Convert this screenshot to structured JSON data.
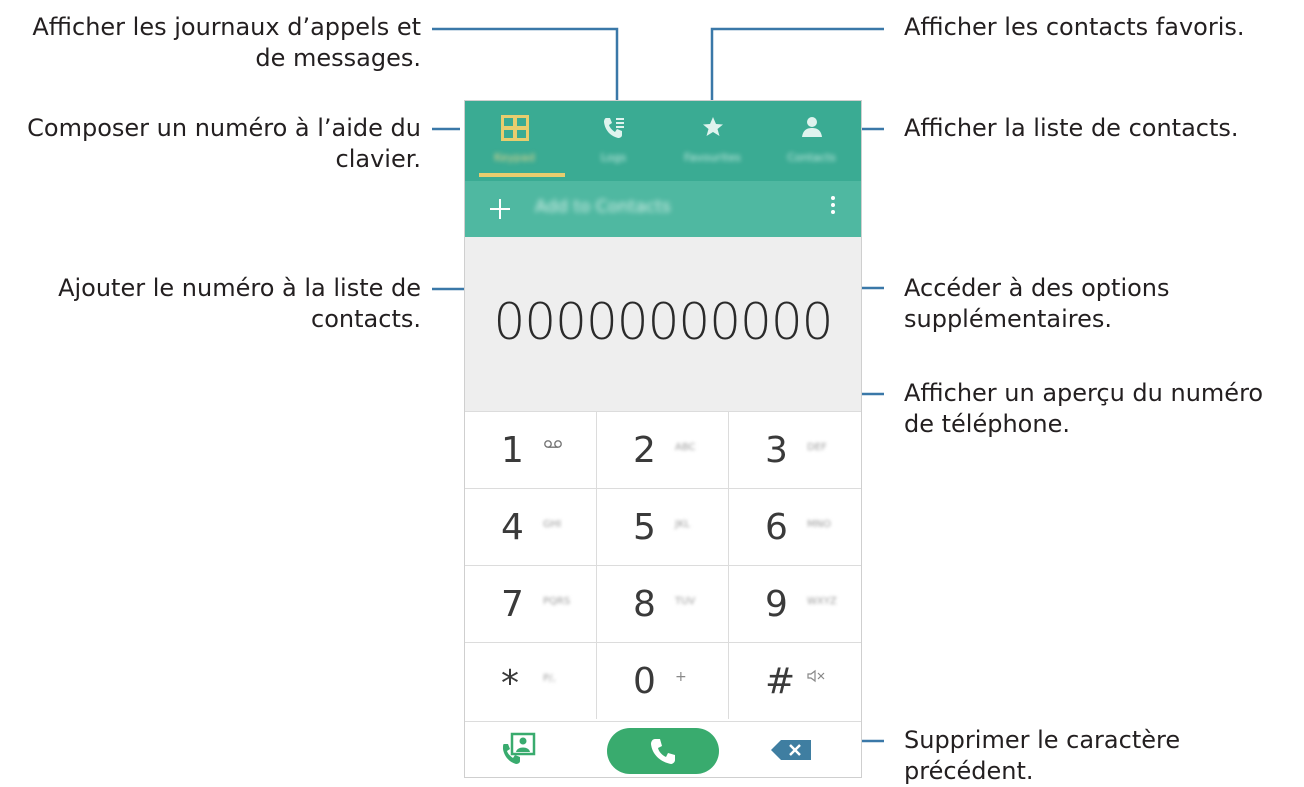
{
  "callouts": {
    "logs": "Afficher les journaux d’appels et de messages.",
    "keypad": "Composer un numéro à l’aide du clavier.",
    "add_contact": "Ajouter le numéro à la liste de contacts.",
    "favourites": "Afficher les contacts favoris.",
    "contacts": "Afficher la liste de contacts.",
    "more_options": "Accéder à des options supplémentaires.",
    "preview": "Afficher un aperçu du numéro de téléphone.",
    "delete": "Supprimer le caractère précédent."
  },
  "tabs": [
    {
      "label": "Keypad",
      "icon": "keypad-icon",
      "active": true
    },
    {
      "label": "Logs",
      "icon": "call-log-icon",
      "active": false
    },
    {
      "label": "Favourites",
      "icon": "star-icon",
      "active": false
    },
    {
      "label": "Contacts",
      "icon": "person-icon",
      "active": false
    }
  ],
  "actionbar": {
    "add_label": "Add to Contacts"
  },
  "display": {
    "number": "00000000000"
  },
  "keys": [
    {
      "digit": "1",
      "sub": "ഠഠ"
    },
    {
      "digit": "2",
      "sub": "ABC"
    },
    {
      "digit": "3",
      "sub": "DEF"
    },
    {
      "digit": "4",
      "sub": "GHI"
    },
    {
      "digit": "5",
      "sub": "JKL"
    },
    {
      "digit": "6",
      "sub": "MNO"
    },
    {
      "digit": "7",
      "sub": "PQRS"
    },
    {
      "digit": "8",
      "sub": "TUV"
    },
    {
      "digit": "9",
      "sub": "WXYZ"
    },
    {
      "digit": "*",
      "sub": "P/,"
    },
    {
      "digit": "0",
      "sub": "+"
    },
    {
      "digit": "#",
      "sub": "🔇"
    }
  ],
  "colors": {
    "header": "#3aab93",
    "actionbar": "#4fb8a1",
    "call": "#39ab6e",
    "accent": "#e8cd6e",
    "backspace": "#3f7ea1"
  }
}
